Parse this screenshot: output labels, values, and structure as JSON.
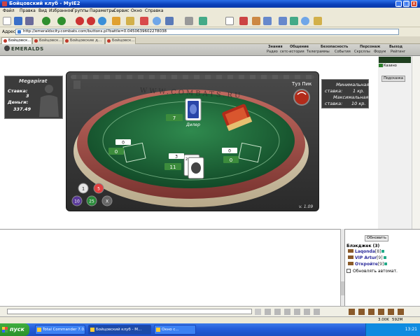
{
  "window": {
    "title": "Бойцовский клуб - MyIE2",
    "min": "_",
    "max": "□",
    "close": "x"
  },
  "menu": [
    "Файл",
    "Правка",
    "Вид",
    "Избранное",
    "Группы",
    "Параметры",
    "Сервис",
    "Окно",
    "Справка"
  ],
  "address": {
    "label": "Адрес",
    "url": "http://emeraldscity.combats.com/buttons.pl?battle=0.0450639602278038"
  },
  "tabs": [
    "Бойцовск...",
    "Бойцовск...",
    "Бойцовские д...",
    "Бойцовск..."
  ],
  "site": {
    "logo": "EMERALDS",
    "nav_top": [
      "Знания",
      "Общение",
      "Безопасность",
      "Персонаж",
      "Выход"
    ],
    "nav_bottom": [
      "Радио",
      "сетс-история",
      "Телеграммы",
      "События",
      "Скрсллы",
      "Форум",
      "Рейтинг"
    ]
  },
  "player": {
    "name": "Megapirat",
    "bet_label": "Ставка:",
    "bet_value": "3",
    "money_label": "Деньги:",
    "money_value": "337.49"
  },
  "table": {
    "url_text": "WWW.COMBATS.RU",
    "room_name": "Туз Пик",
    "dealer_label": "Дилер",
    "dealer_score": "7",
    "player_score": "11",
    "center_bet": "3",
    "left_bet": "0",
    "left_score": "0",
    "right_bet": "0",
    "right_score": "0",
    "version": "v. 1.09",
    "chips": [
      "1",
      "5",
      "10",
      "25",
      "X"
    ]
  },
  "betbox": {
    "min_label": "Минимальная",
    "min_bet_label": "ставка:",
    "min_value": "1 кр.",
    "max_label": "Максимальная",
    "max_bet_label": "ставка:",
    "max_value": "10 кр."
  },
  "side": {
    "kazino": "Казино",
    "hint": "Подсказка"
  },
  "users_panel": {
    "refresh": "Обновить",
    "header": "Блэкджек (3)",
    "users": [
      {
        "name": "Laqonda",
        "level": "[8]"
      },
      {
        "name": "VIP Artur",
        "level": "[9]"
      },
      {
        "name": "Откройте",
        "level": "[9]"
      }
    ],
    "auto_label": "Обновлять автомат."
  },
  "status": {
    "speed": "3.00K",
    "mem": "592M",
    "time1": "13:21"
  },
  "taskbar": {
    "start": "пуск",
    "items": [
      "Total Commander 7.0...",
      "Бойцовский клуб - M...",
      "Окно с..."
    ],
    "clock": "13:21"
  },
  "colors": {
    "felt": "#1f6a3e",
    "rail": "#a8554e",
    "accent_green": "#3c8c3c"
  }
}
